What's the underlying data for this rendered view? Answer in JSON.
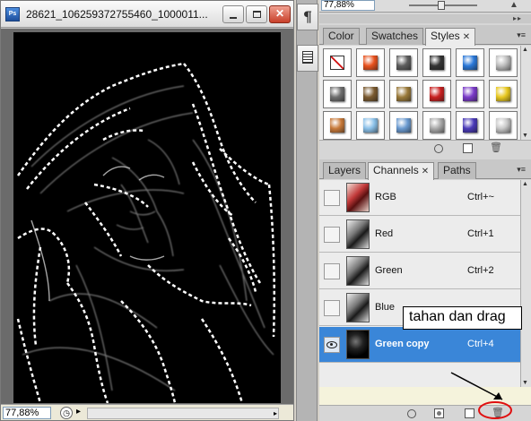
{
  "document": {
    "app_icon_text": "Ps",
    "title": "28621_106259372755460_1000011...",
    "zoom": "77,88%",
    "close_glyph": "✕"
  },
  "dock": {
    "paragraph_glyph": "¶"
  },
  "top_bar": {
    "zoom": "77,88%"
  },
  "styles_panel": {
    "tabs": [
      {
        "label": "Color"
      },
      {
        "label": "Swatches"
      },
      {
        "label": "Styles"
      }
    ],
    "active_tab": "Styles",
    "tab_close_glyph": "✕",
    "menu_glyph": "▾≡",
    "swatches": [
      {
        "icon": "none-style-icon",
        "color": "#ffffff"
      },
      {
        "icon": "glow-orange-style",
        "color": "#e8521e"
      },
      {
        "icon": "gray-bevel-style",
        "color": "#5e5e5e"
      },
      {
        "icon": "dark-button-style",
        "color": "#333333"
      },
      {
        "icon": "blue-glass-style",
        "color": "#2a78d8"
      },
      {
        "icon": "light-gray-style",
        "color": "#bdbdbd"
      },
      {
        "icon": "steel-style",
        "color": "#6f6f6f"
      },
      {
        "icon": "bronze-style",
        "color": "#7a5a30"
      },
      {
        "icon": "brass-style",
        "color": "#9a7a3a"
      },
      {
        "icon": "red-glass-style",
        "color": "#c82020"
      },
      {
        "icon": "rainbow-style",
        "color": "#7a3ac8"
      },
      {
        "icon": "gold-style",
        "color": "#e8c820"
      },
      {
        "icon": "copper-style",
        "color": "#c87a3a"
      },
      {
        "icon": "sky-style",
        "color": "#8ac0e8"
      },
      {
        "icon": "landscape-style",
        "color": "#6a9ad0"
      },
      {
        "icon": "pattern-style",
        "color": "#aaaaaa"
      },
      {
        "icon": "purple-glass-style",
        "color": "#4a3ab8"
      },
      {
        "icon": "silver-style",
        "color": "#c8c8c8"
      }
    ]
  },
  "channels_panel": {
    "tabs": [
      {
        "label": "Layers"
      },
      {
        "label": "Channels"
      },
      {
        "label": "Paths"
      }
    ],
    "active_tab": "Channels",
    "tab_close_glyph": "✕",
    "channels": [
      {
        "name": "RGB",
        "shortcut": "Ctrl+~",
        "visible": false,
        "selected": false,
        "thumb": "rgb"
      },
      {
        "name": "Red",
        "shortcut": "Ctrl+1",
        "visible": false,
        "selected": false,
        "thumb": "gray"
      },
      {
        "name": "Green",
        "shortcut": "Ctrl+2",
        "visible": false,
        "selected": false,
        "thumb": "gray"
      },
      {
        "name": "Blue",
        "shortcut": "",
        "visible": false,
        "selected": false,
        "thumb": "gray"
      },
      {
        "name": "Green copy",
        "shortcut": "Ctrl+4",
        "visible": true,
        "selected": true,
        "thumb": "dark"
      }
    ]
  },
  "annotation": {
    "text": "tahan dan drag",
    "arrow_color": "#000000",
    "highlight_color": "#e01010"
  },
  "colors": {
    "selection_blue": "#3a86d8",
    "canvas_black": "#000000",
    "marching_ants": "#ffffff"
  }
}
